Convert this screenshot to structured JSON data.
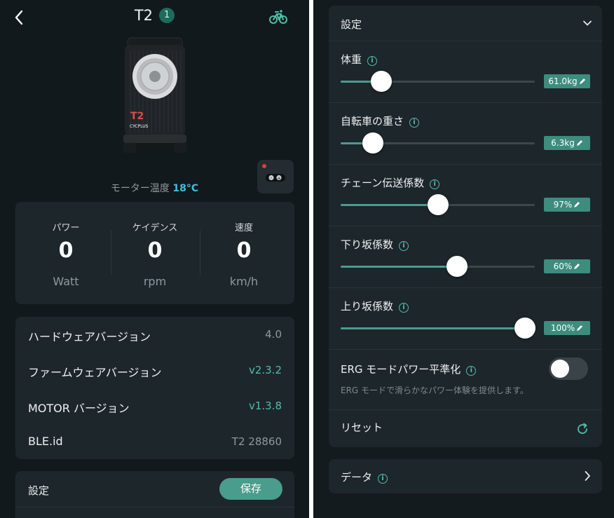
{
  "left": {
    "header": {
      "title": "T2",
      "badge": "1",
      "back_icon": "chevron-left-icon",
      "bike_icon": "bike-icon"
    },
    "device": {
      "brand": "CYCPLUS",
      "model_mark": "T2"
    },
    "motor_temp": {
      "label": "モーター温度",
      "value": "18°C"
    },
    "remote": {
      "minus": "-",
      "plus": "+"
    },
    "stats": [
      {
        "label": "パワー",
        "value": "0",
        "unit": "Watt"
      },
      {
        "label": "ケイデンス",
        "value": "0",
        "unit": "rpm"
      },
      {
        "label": "速度",
        "value": "0",
        "unit": "km/h"
      }
    ],
    "versions": [
      {
        "key": "ハードウェアバージョン",
        "value": "4.0"
      },
      {
        "key": "ファームウェアバージョン",
        "value": "v2.3.2"
      },
      {
        "key": "MOTOR バージョン",
        "value": "v1.3.8"
      },
      {
        "key": "BLE.id",
        "value": "T2 28860"
      }
    ],
    "settings": {
      "label": "設定",
      "save_label": "保存"
    }
  },
  "right": {
    "settings_header": "設定",
    "sliders": [
      {
        "label": "体重",
        "value": "61.0kg",
        "level": 0.21
      },
      {
        "label": "自転車の重さ",
        "value": "6.3kg",
        "level": 0.165
      },
      {
        "label": "チェーン伝送係数",
        "value": "97%",
        "level": 0.5
      },
      {
        "label": "下り坂係数",
        "value": "60%",
        "level": 0.6
      },
      {
        "label": "上り坂係数",
        "value": "100%",
        "level": 0.95
      }
    ],
    "erg": {
      "label": "ERG モードパワー平準化",
      "description": "ERG モードで滑らかなパワー体験を提供します。",
      "enabled": false
    },
    "reset_label": "リセット",
    "data_label": "データ"
  },
  "colors": {
    "accent": "#4a9c8c",
    "temp": "#3fc0d8",
    "background": "#12191d",
    "card": "#1d262b"
  }
}
